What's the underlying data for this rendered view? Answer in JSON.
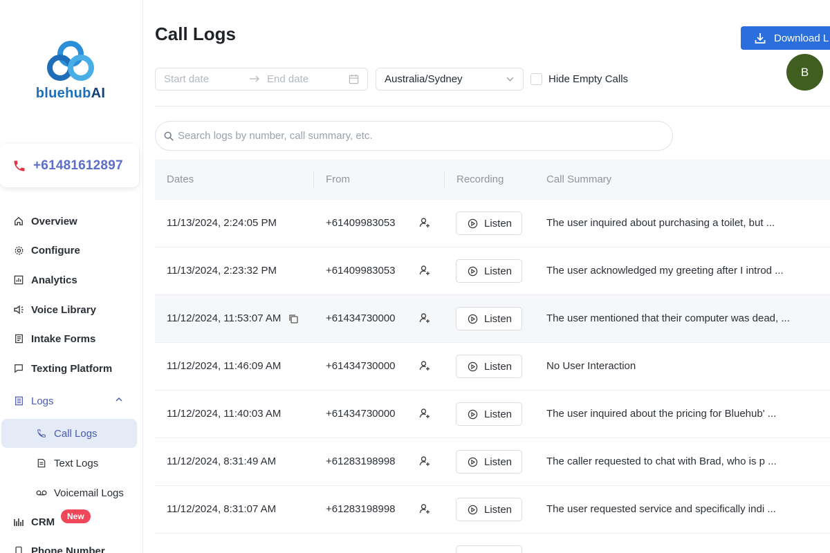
{
  "brand": {
    "name_part1": "bluehub",
    "name_part2": "AI"
  },
  "phone": {
    "number": "+61481612897"
  },
  "nav": {
    "overview": "Overview",
    "configure": "Configure",
    "analytics": "Analytics",
    "voice_library": "Voice Library",
    "intake_forms": "Intake Forms",
    "texting_platform": "Texting Platform",
    "logs": "Logs",
    "call_logs": "Call Logs",
    "text_logs": "Text Logs",
    "voicemail_logs": "Voicemail Logs",
    "crm": "CRM",
    "crm_badge": "New",
    "phone_number": "Phone Number"
  },
  "header": {
    "title": "Call Logs",
    "download_label": "Download L",
    "avatar_initial": "B"
  },
  "filters": {
    "start_placeholder": "Start date",
    "end_placeholder": "End date",
    "timezone": "Australia/Sydney",
    "hide_empty_label": "Hide Empty Calls",
    "hide_empty_checked": false
  },
  "search": {
    "placeholder": "Search logs by number, call summary, etc."
  },
  "table": {
    "columns": {
      "dates": "Dates",
      "from": "From",
      "recording": "Recording",
      "summary": "Call Summary"
    },
    "listen_label": "Listen",
    "rows": [
      {
        "date": "11/13/2024, 2:24:05 PM",
        "from": "+61409983053",
        "summary": "The user inquired about purchasing a toilet, but ..."
      },
      {
        "date": "11/13/2024, 2:23:32 PM",
        "from": "+61409983053",
        "summary": "The user acknowledged my greeting after I introd ..."
      },
      {
        "date": "11/12/2024, 11:53:07 AM",
        "from": "+61434730000",
        "summary": "The user mentioned that their computer was dead, ..."
      },
      {
        "date": "11/12/2024, 11:46:09 AM",
        "from": "+61434730000",
        "summary": "No User Interaction"
      },
      {
        "date": "11/12/2024, 11:40:03 AM",
        "from": "+61434730000",
        "summary": "The user inquired about the pricing for Bluehub' ..."
      },
      {
        "date": "11/12/2024, 8:31:49 AM",
        "from": "+61283198998",
        "summary": "The caller requested to chat with Brad, who is p ..."
      },
      {
        "date": "11/12/2024, 8:31:07 AM",
        "from": "+61283198998",
        "summary": "The user requested service and specifically indi ..."
      }
    ]
  },
  "colors": {
    "accent": "#2a6fdb",
    "nav_active": "#4a5bb4",
    "phone_red": "#e0364a",
    "avatar_bg": "#3f5e1f",
    "badge_bg": "#f0465a"
  }
}
